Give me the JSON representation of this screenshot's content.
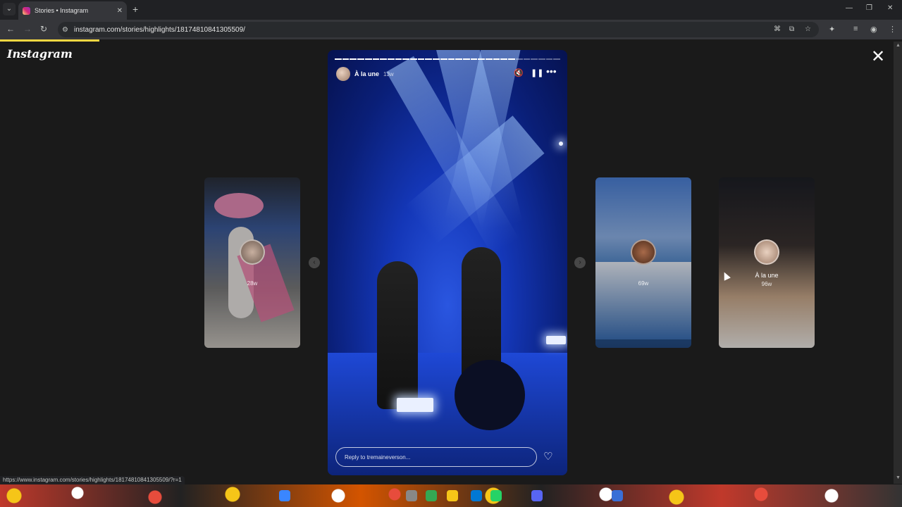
{
  "browser": {
    "tab_title": "Stories • Instagram",
    "url": "instagram.com/stories/highlights/18174810841305509/",
    "status_url": "https://www.instagram.com/stories/highlights/18174810841305509/?r=1",
    "load_progress": 0.11
  },
  "page": {
    "logo": "Instagram"
  },
  "story": {
    "user": "À la une",
    "time": "13w",
    "reply_placeholder": "Reply to tremaineverson...",
    "segments_total": 30,
    "segments_done": 24
  },
  "side_stories": [
    {
      "label": "",
      "time": "28w"
    },
    {
      "label": "",
      "time": "69w"
    },
    {
      "label": "À la une",
      "time": "96w"
    }
  ],
  "icons": {
    "mute": "mute-icon",
    "pause": "pause-icon",
    "more": "more-icon",
    "heart": "heart-icon",
    "close": "close-icon"
  },
  "colors": {
    "loadbar": "#f5d742",
    "page_bg": "#1a1a1a"
  }
}
